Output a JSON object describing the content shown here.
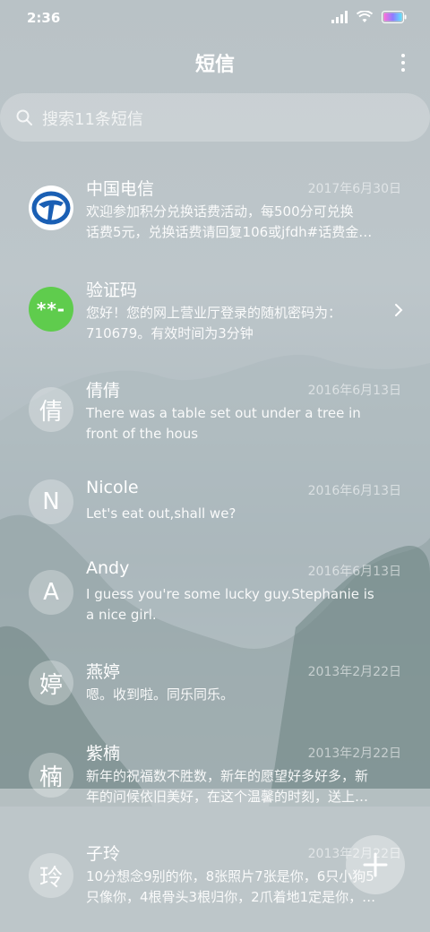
{
  "status": {
    "time": "2:36"
  },
  "header": {
    "title": "短信",
    "more_icon": "more-vertical-icon"
  },
  "search": {
    "placeholder": "搜索11条短信",
    "icon": "search-icon"
  },
  "conversations": [
    {
      "name": "中国电信",
      "date": "2017年6月30日",
      "preview_line1": "欢迎参加积分兑换话费活动，每500分可兑换",
      "preview_line2": "话费5元，兑换话费请回复106或jfdh#话费金…",
      "avatar": "china-telecom-logo"
    },
    {
      "name": "验证码",
      "date": "",
      "preview_line1": "您好！您的网上营业厅登录的随机密码为：",
      "preview_line2": "710679。有效时间为3分钟",
      "avatar_text": "**-"
    },
    {
      "name": "倩倩",
      "date": "2016年6月13日",
      "preview_line1": "There was a table set out under a tree in",
      "preview_line2": "front of the hous",
      "avatar_text": "倩"
    },
    {
      "name": "Nicole",
      "date": "2016年6月13日",
      "preview_line1": "Let's eat out,shall we?",
      "preview_line2": "",
      "avatar_text": "N"
    },
    {
      "name": "Andy",
      "date": "2016年6月13日",
      "preview_line1": "I guess you're some lucky guy.Stephanie is",
      "preview_line2": "a nice girl.",
      "avatar_text": "A"
    },
    {
      "name": "燕婷",
      "date": "2013年2月22日",
      "preview_line1": "嗯。收到啦。同乐同乐。",
      "preview_line2": "",
      "avatar_text": "婷"
    },
    {
      "name": "紫楠",
      "date": "2013年2月22日",
      "preview_line1": "新年的祝福数不胜数，新年的愿望好多好多，新",
      "preview_line2": "年的问候依旧美好，在这个温馨的时刻，送上…",
      "avatar_text": "楠"
    },
    {
      "name": "子玲",
      "date": "2013年2月22日",
      "preview_line1": "10分想念9别的你，8张照片7张是你，6只小狗5",
      "preview_line2": "只像你，4根骨头3根归你，2爪着地1定是你，…",
      "avatar_text": "玲"
    }
  ],
  "fab": {
    "icon": "plus-icon"
  },
  "colors": {
    "verification_green": "#5fcc4d",
    "telecom_blue": "#1a5fb4"
  }
}
